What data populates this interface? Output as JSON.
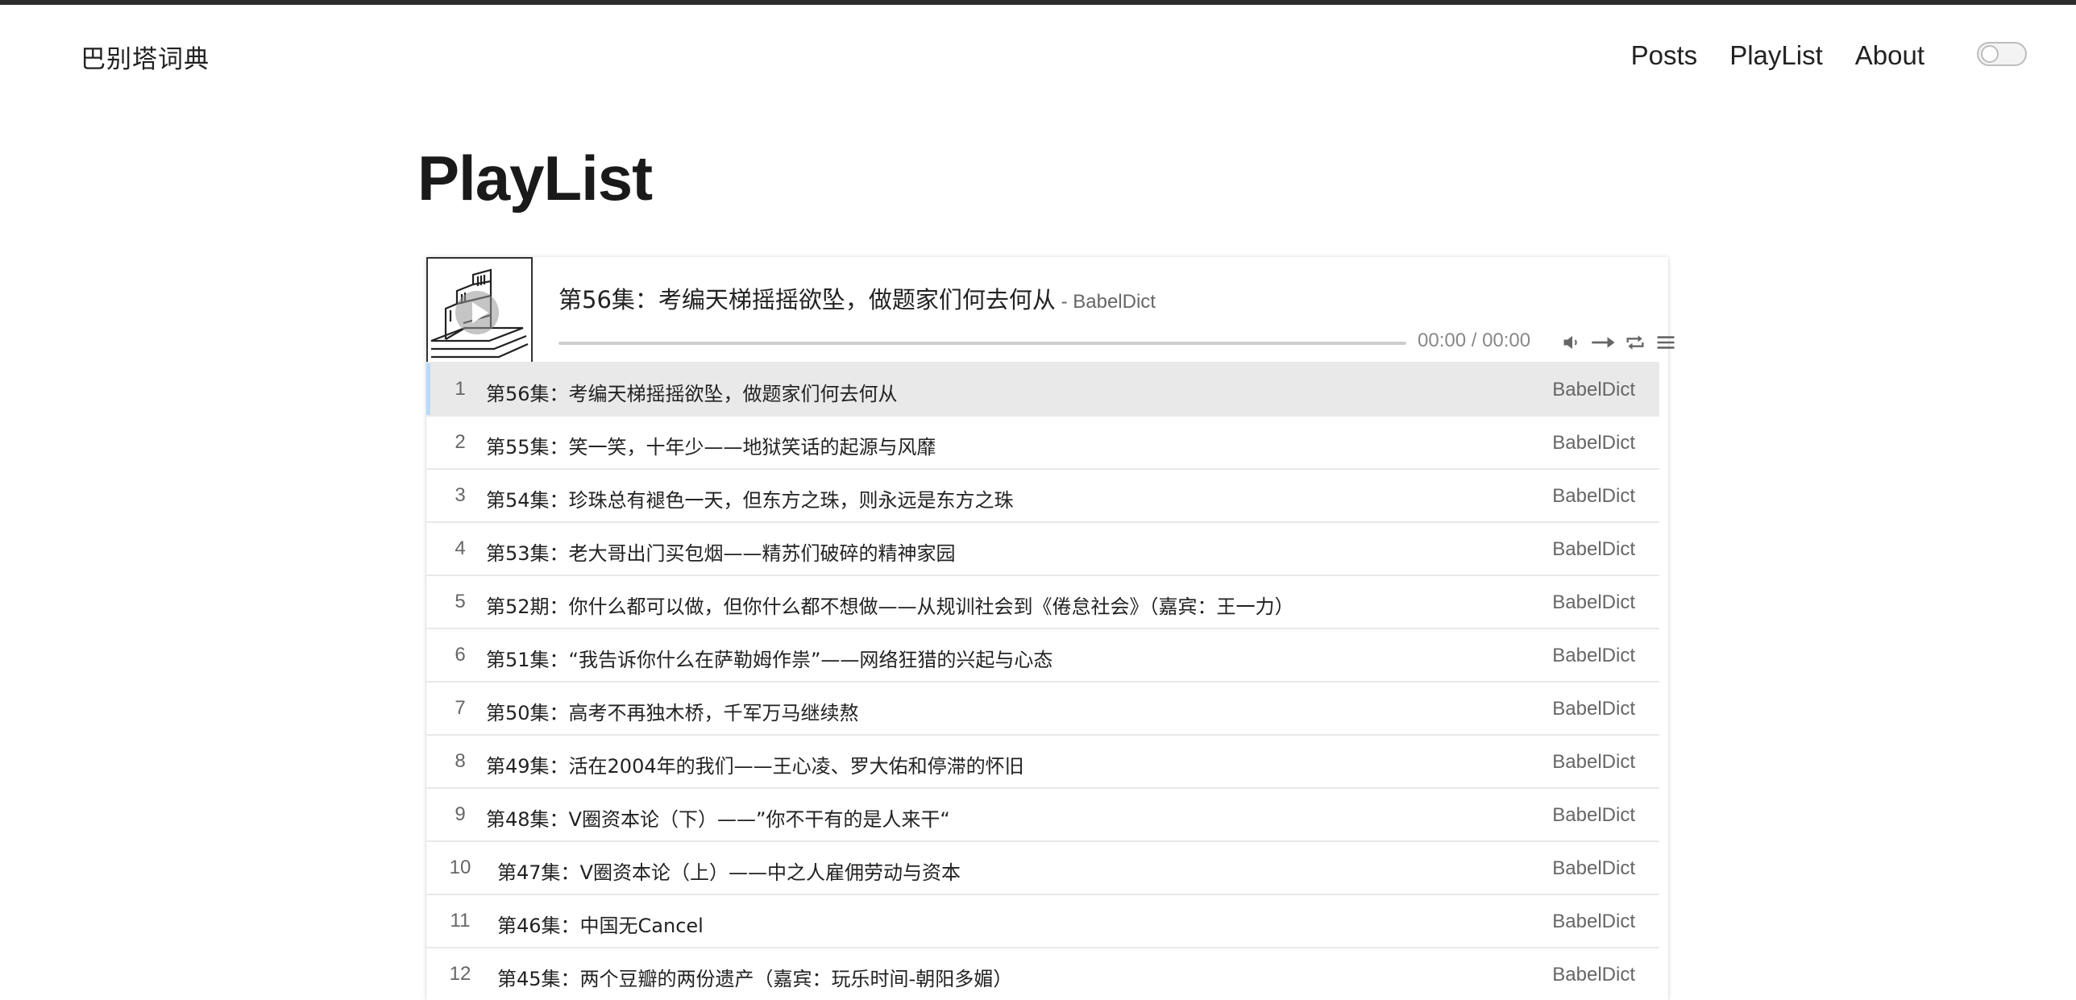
{
  "site": {
    "logo": "巴别塔词典",
    "nav": [
      "Posts",
      "PlayList",
      "About"
    ]
  },
  "page": {
    "title": "PlayList"
  },
  "player": {
    "now_playing": {
      "title": "第56集：考编天梯摇摇欲坠，做题家们何去何从",
      "author": " - BabelDict"
    },
    "time": "00:00 / 00:00",
    "progress": 0,
    "icons": [
      "play-icon",
      "volume-icon",
      "order-icon",
      "loop-icon",
      "menu-icon"
    ],
    "accent_color": "#b7daff"
  },
  "playlist": [
    {
      "index": "1",
      "title": "第56集：考编天梯摇摇欲坠，做题家们何去何从",
      "author": "BabelDict"
    },
    {
      "index": "2",
      "title": "第55集：笑一笑，十年少——地狱笑话的起源与风靡",
      "author": "BabelDict"
    },
    {
      "index": "3",
      "title": "第54集：珍珠总有褪色一天，但东方之珠，则永远是东方之珠",
      "author": "BabelDict"
    },
    {
      "index": "4",
      "title": "第53集：老大哥出门买包烟——精苏们破碎的精神家园",
      "author": "BabelDict"
    },
    {
      "index": "5",
      "title": "第52期：你什么都可以做，但你什么都不想做——从规训社会到《倦怠社会》（嘉宾：王一力）",
      "author": "BabelDict"
    },
    {
      "index": "6",
      "title": "第51集：“我告诉你什么在萨勒姆作祟”——网络狂猎的兴起与心态",
      "author": "BabelDict"
    },
    {
      "index": "7",
      "title": "第50集：高考不再独木桥，千军万马继续熬",
      "author": "BabelDict"
    },
    {
      "index": "8",
      "title": "第49集：活在2004年的我们——王心凌、罗大佑和停滞的怀旧",
      "author": "BabelDict"
    },
    {
      "index": "9",
      "title": "第48集：V圈资本论（下）——”你不干有的是人来干“",
      "author": "BabelDict"
    },
    {
      "index": "10",
      "title": "第47集：V圈资本论（上）——中之人雇佣劳动与资本",
      "author": "BabelDict"
    },
    {
      "index": "11",
      "title": "第46集：中国无Cancel",
      "author": "BabelDict"
    },
    {
      "index": "12",
      "title": "第45集：两个豆瓣的两份遗产（嘉宾：玩乐时间-朝阳多媚）",
      "author": "BabelDict"
    }
  ]
}
